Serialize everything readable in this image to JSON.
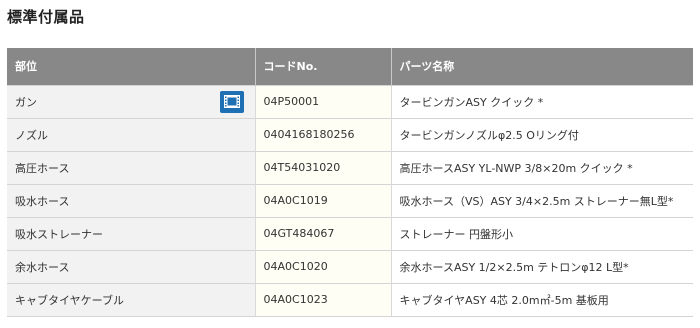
{
  "title": "標準付属品",
  "table": {
    "headers": [
      "部位",
      "コードNo.",
      "パーツ名称"
    ],
    "rows": [
      {
        "part": "ガン",
        "code": "04P50001",
        "name": "タービンガンASY クイック *",
        "video_icon": "film-icon"
      },
      {
        "part": "ノズル",
        "code": "0404168180256",
        "name": "タービンガンノズルφ2.5 Oリング付"
      },
      {
        "part": "高圧ホース",
        "code": "04T54031020",
        "name": "高圧ホースASY YL-NWP 3/8×20m クイック *"
      },
      {
        "part": "吸水ホース",
        "code": "04A0C1019",
        "name": "吸水ホース（VS）ASY 3/4×2.5m ストレーナー無L型*"
      },
      {
        "part": "吸水ストレーナー",
        "code": "04GT484067",
        "name": "ストレーナー 円盤形小"
      },
      {
        "part": "余水ホース",
        "code": "04A0C1020",
        "name": "余水ホースASY 1/2×2.5m テトロンφ12 L型*"
      },
      {
        "part": "キャブタイヤケーブル",
        "code": "04A0C1023",
        "name": "キャブタイヤASY 4芯 2.0m㎡-5m 基板用"
      }
    ]
  },
  "colors": {
    "header_bg": "#888888",
    "part_col_bg": "#f2f2f2",
    "code_col_bg": "#fefef4",
    "video_button": "#1f6fb5"
  }
}
